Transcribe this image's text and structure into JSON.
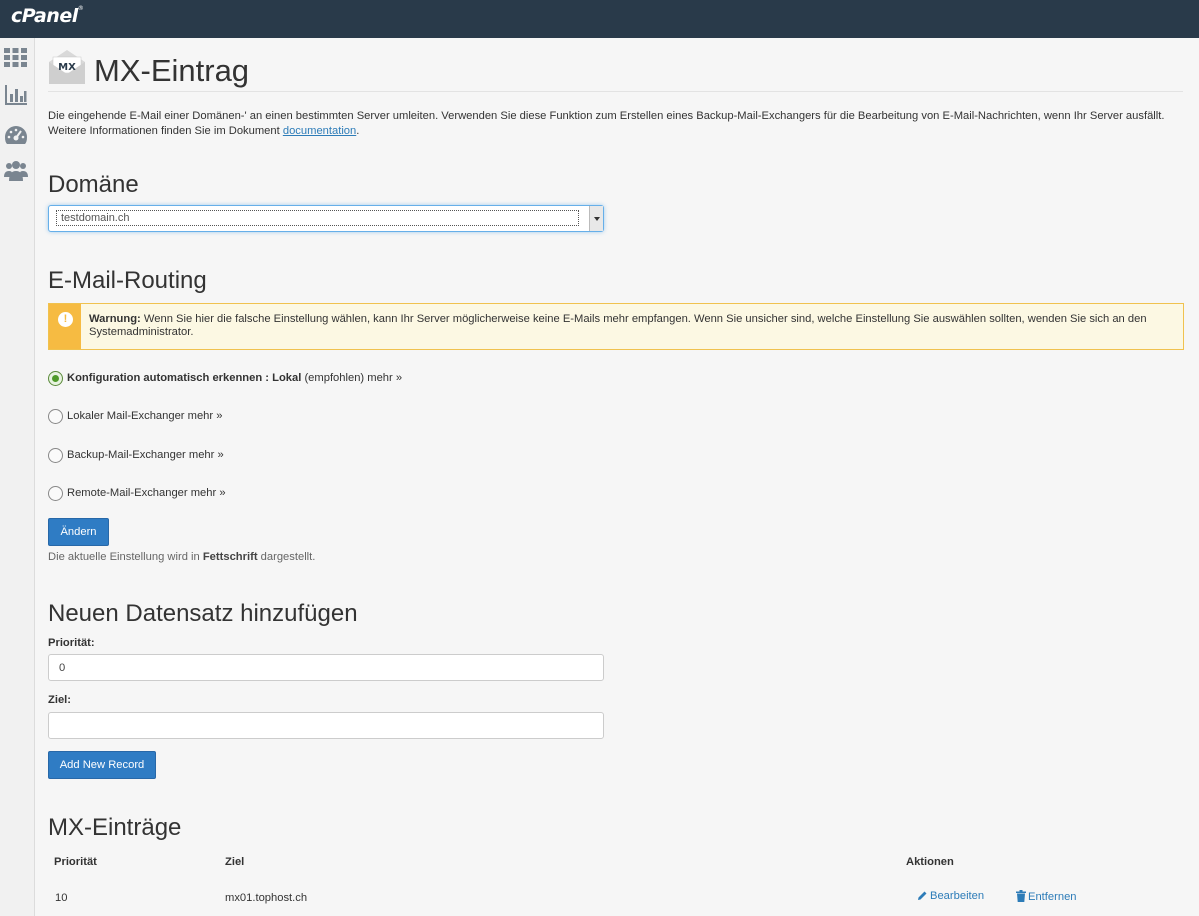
{
  "brand": {
    "logo_text": "cPanel",
    "logo_mark": "®"
  },
  "sidebar": {
    "items": [
      {
        "icon": "grid-icon"
      },
      {
        "icon": "bar-chart-icon"
      },
      {
        "icon": "dashboard-gauge-icon"
      },
      {
        "icon": "users-icon"
      }
    ]
  },
  "header": {
    "icon_text": "MX",
    "title": "MX-Eintrag"
  },
  "description": {
    "text": "Die eingehende E-Mail einer Domänen-' an einen bestimmten Server umleiten. Verwenden Sie diese Funktion zum Erstellen eines Backup-Mail-Exchangers für die Bearbeitung von E-Mail-Nachrichten, wenn Ihr Server ausfällt. Weitere Informationen finden Sie im Dokument ",
    "link": "documentation",
    "end": "."
  },
  "domain": {
    "heading": "Domäne",
    "selected": "testdomain.ch"
  },
  "routing": {
    "heading": "E-Mail-Routing",
    "warning_label": "Warnung:",
    "warning_text": " Wenn Sie hier die falsche Einstellung wählen, kann Ihr Server möglicherweise keine E-Mails mehr empfangen. Wenn Sie unsicher sind, welche Einstellung Sie auswählen sollten, wenden Sie sich an den Systemadministrator.",
    "options": [
      {
        "label_bold": "Konfiguration automatisch erkennen : Lokal",
        "label": " (empfohlen)",
        "more": " mehr »",
        "checked": true
      },
      {
        "label": "Lokaler Mail-Exchanger",
        "more": " mehr »",
        "checked": false
      },
      {
        "label": "Backup-Mail-Exchanger",
        "more": " mehr »",
        "checked": false
      },
      {
        "label": "Remote-Mail-Exchanger",
        "more": " mehr »",
        "checked": false
      }
    ],
    "change_button": "Ändern",
    "hint_pre": "Die aktuelle Einstellung wird in ",
    "hint_bold": "Fettschrift",
    "hint_post": " dargestellt."
  },
  "add_record": {
    "heading": "Neuen Datensatz hinzufügen",
    "priority_label": "Priorität:",
    "priority_value": "0",
    "target_label": "Ziel:",
    "target_value": "",
    "button": "Add New Record"
  },
  "entries": {
    "heading": "MX-Einträge",
    "columns": [
      "Priorität",
      "Ziel",
      "Aktionen"
    ],
    "rows": [
      {
        "priority": "10",
        "target": "mx01.tophost.ch",
        "edit": "Bearbeiten",
        "remove": "Entfernen"
      }
    ]
  },
  "colors": {
    "topbar": "#293a4a",
    "primary_button": "#2f7cc4",
    "warning": "#f6bb42",
    "link": "#2d7cb8"
  }
}
